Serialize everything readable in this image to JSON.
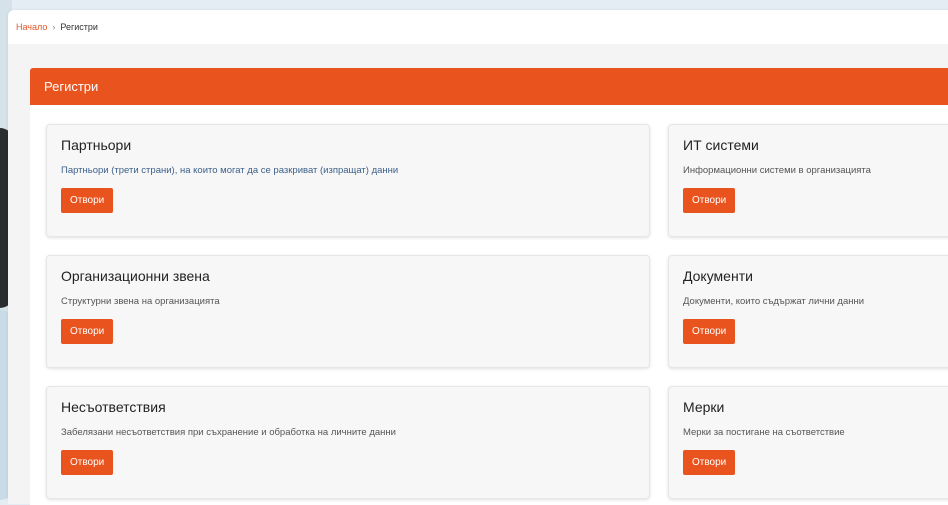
{
  "breadcrumb": {
    "home": "Начало",
    "separator": "›",
    "current": "Регистри"
  },
  "section": {
    "title": "Регистри"
  },
  "cards": [
    {
      "title": "Партньори",
      "description": "Партньори (трети страни), на които могат да се разкриват (изпращат) данни",
      "button": "Отвори"
    },
    {
      "title": "ИТ системи",
      "description": "Информационни системи в организацията",
      "button": "Отвори"
    },
    {
      "title": "Организационни звена",
      "description": "Структурни звена на организацията",
      "button": "Отвори"
    },
    {
      "title": "Документи",
      "description": "Документи, които съдържат лични данни",
      "button": "Отвори"
    },
    {
      "title": "Несъответствия",
      "description": "Забелязани несъответствия при съхранение и обработка на личните данни",
      "button": "Отвори"
    },
    {
      "title": "Мерки",
      "description": "Мерки за постигане на съответствие",
      "button": "Отвори"
    }
  ],
  "colors": {
    "accent": "#e8531e",
    "link": "#e2572a"
  }
}
